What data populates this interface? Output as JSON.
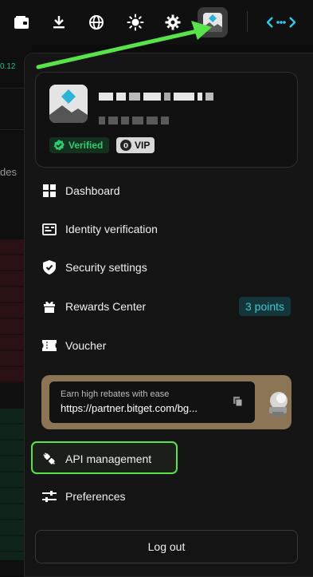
{
  "background": {
    "price_snippet": "0.12",
    "text_snippet": "des"
  },
  "toolbar": {
    "icons": [
      "wallet-icon",
      "download-icon",
      "globe-icon",
      "theme-sun-icon",
      "settings-gear-icon",
      "user-avatar-icon",
      "connect-icon"
    ]
  },
  "profile": {
    "verified_label": "Verified",
    "vip_label": "VIP"
  },
  "menu": {
    "items": [
      {
        "label": "Dashboard",
        "icon": "dashboard-grid-icon"
      },
      {
        "label": "Identity verification",
        "icon": "id-card-icon"
      },
      {
        "label": "Security settings",
        "icon": "shield-check-icon"
      },
      {
        "label": "Rewards Center",
        "icon": "gift-icon"
      },
      {
        "label": "Voucher",
        "icon": "ticket-icon"
      },
      {
        "label": "API management",
        "icon": "plug-icon"
      },
      {
        "label": "Preferences",
        "icon": "sliders-icon"
      }
    ],
    "rewards_points": "3 points"
  },
  "rebate": {
    "title": "Earn high rebates with ease",
    "link": "https://partner.bitget.com/bg..."
  },
  "logout_label": "Log out",
  "colors": {
    "accent_green": "#59e34a",
    "verified_green": "#2ecc71",
    "points_teal": "#3fc8d0"
  }
}
